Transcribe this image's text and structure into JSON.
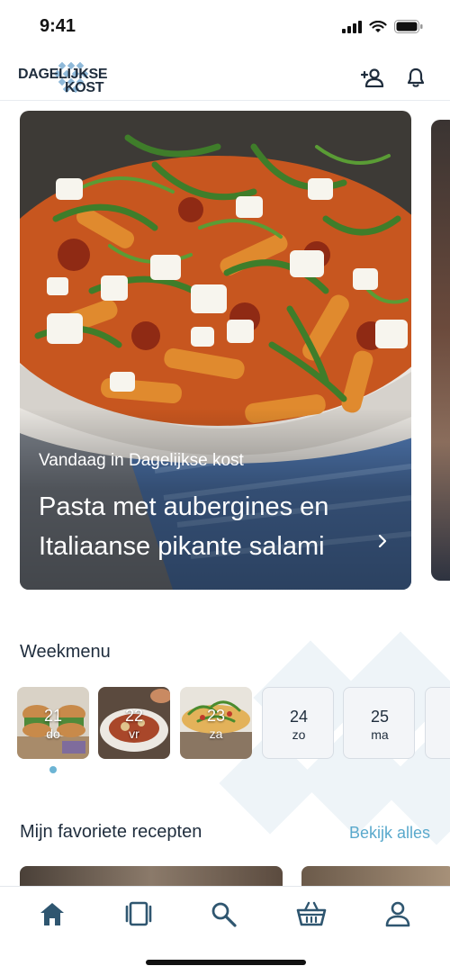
{
  "status_bar": {
    "time": "9:41"
  },
  "header": {
    "logo_line1": "DAGELIJKSE",
    "logo_line2": "KOST",
    "icons": [
      "add-user-icon",
      "bell-icon"
    ]
  },
  "hero": {
    "kicker": "Vandaag in Dagelijkse kost",
    "title": "Pasta met aubergines en Italiaanse pikante salami"
  },
  "weekmenu": {
    "title": "Weekmenu",
    "days": [
      {
        "num": "21",
        "name": "do",
        "has_photo": true
      },
      {
        "num": "22",
        "name": "vr",
        "has_photo": true
      },
      {
        "num": "23",
        "name": "za",
        "has_photo": true
      },
      {
        "num": "24",
        "name": "zo",
        "has_photo": false
      },
      {
        "num": "25",
        "name": "ma",
        "has_photo": false
      }
    ]
  },
  "favorites": {
    "title": "Mijn favoriete recepten",
    "link": "Bekijk alles"
  },
  "tab_bar": {
    "items": [
      "home-icon",
      "book-icon",
      "search-icon",
      "basket-icon",
      "profile-icon"
    ]
  },
  "colors": {
    "accent": "#5aa9cc",
    "text": "#1f2d3d",
    "tile_border": "#d7dde4"
  }
}
